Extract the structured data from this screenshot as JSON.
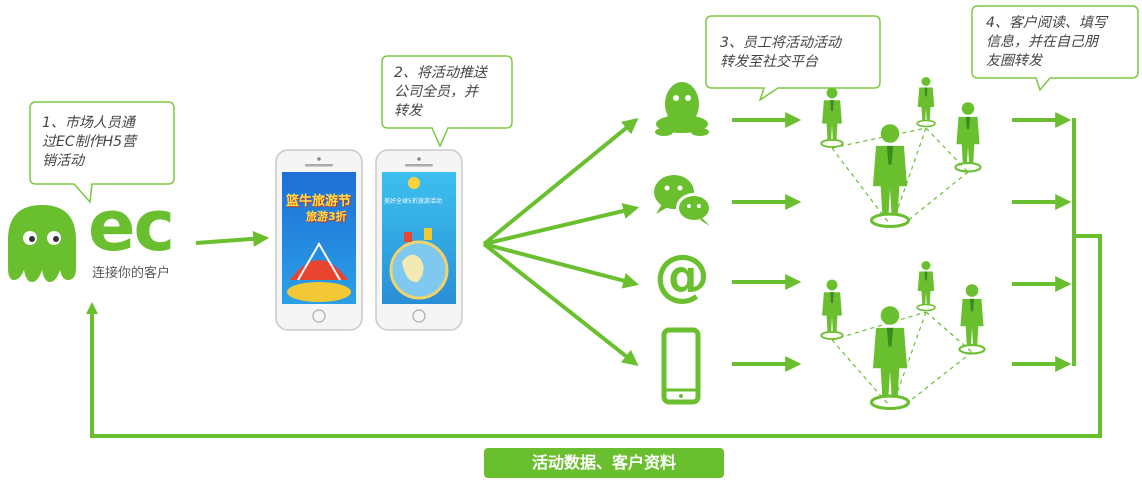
{
  "bubbles": [
    {
      "id": "step1",
      "text": "1、市场人员通\n过EC制作H5营\n销活动"
    },
    {
      "id": "step2",
      "text": "2、将活动推送\n公司全员，并\n转发"
    },
    {
      "id": "step3",
      "text": "3、员工将活动活动\n转发至社交平台"
    },
    {
      "id": "step4",
      "text": "4、客户阅读、填写\n信息，并在自己朋\n友圈转发"
    }
  ],
  "brand": {
    "name": "ec",
    "tagline": "连接你的客户"
  },
  "phones": {
    "left_poster_title": "篮牛旅游节",
    "left_poster_subtitle": "旅游3折",
    "right_poster_text": "美好全球5折旅游活动"
  },
  "platform_icons": [
    "qq-icon",
    "wechat-icon",
    "email-at-icon",
    "mobile-phone-icon"
  ],
  "footer": {
    "label": "活动数据、客户资料"
  },
  "colors": {
    "accent": "#6abf2f",
    "bubble_border": "#7cc843",
    "text": "#444444"
  }
}
